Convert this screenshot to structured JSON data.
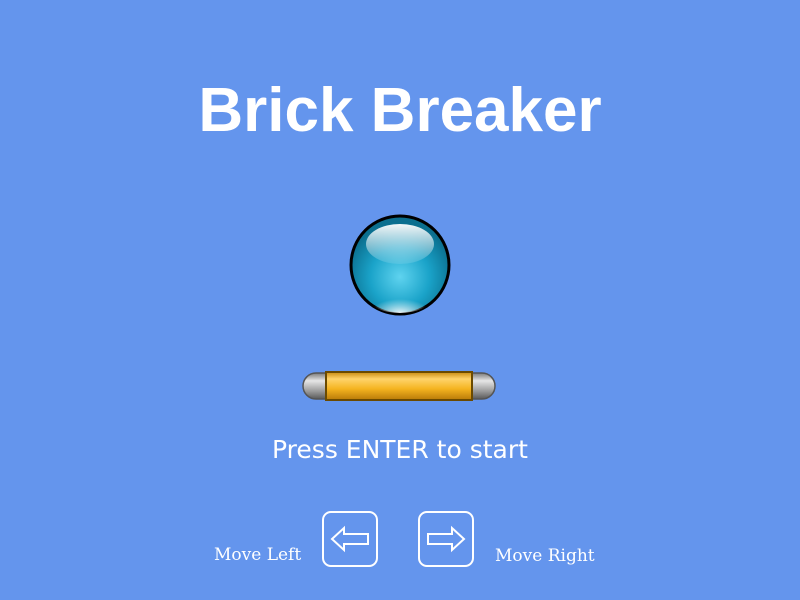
{
  "game": {
    "title": "Brick Breaker",
    "prompt": "Press ENTER to start"
  },
  "controls": {
    "left_label": "Move Left",
    "right_label": "Move Right",
    "left_icon": "arrow-left-icon",
    "right_icon": "arrow-right-icon"
  },
  "colors": {
    "background": "#6495ED",
    "text": "#ffffff",
    "ball": "#1aa3c9",
    "paddle": "#f5b420"
  }
}
